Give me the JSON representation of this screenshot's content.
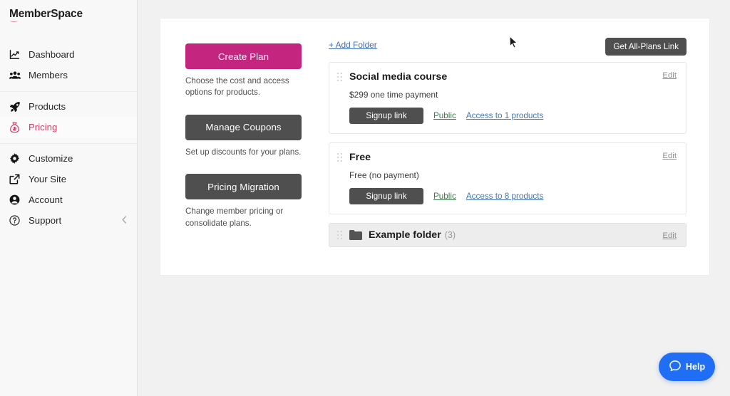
{
  "brand": {
    "name": "MemberSpace"
  },
  "sidebar": {
    "groups": [
      {
        "items": [
          {
            "label": "Dashboard",
            "icon": "chart-line-icon",
            "active": false
          },
          {
            "label": "Members",
            "icon": "users-icon",
            "active": false
          }
        ]
      },
      {
        "items": [
          {
            "label": "Products",
            "icon": "rocket-icon",
            "active": false
          },
          {
            "label": "Pricing",
            "icon": "money-bag-icon",
            "active": true
          }
        ]
      },
      {
        "items": [
          {
            "label": "Customize",
            "icon": "gear-icon",
            "active": false
          },
          {
            "label": "Your Site",
            "icon": "external-link-icon",
            "active": false
          },
          {
            "label": "Account",
            "icon": "user-circle-icon",
            "active": false
          },
          {
            "label": "Support",
            "icon": "question-circle-icon",
            "active": false,
            "trailing_icon": "chevron-left-icon"
          }
        ]
      }
    ]
  },
  "actions": {
    "create_plan": {
      "label": "Create Plan",
      "help": "Choose the cost and access options for products."
    },
    "manage_coupons": {
      "label": "Manage Coupons",
      "help": "Set up discounts for your plans."
    },
    "pricing_migration": {
      "label": "Pricing Migration",
      "help": "Change member pricing or consolidate plans."
    }
  },
  "plans": {
    "add_folder_label": "+ Add Folder",
    "all_plans_label": "Get All-Plans Link",
    "edit_label": "Edit",
    "items": [
      {
        "title": "Social media course",
        "price": "$299 one time payment",
        "signup_label": "Signup link",
        "visibility": "Public",
        "access": "Access to 1 products",
        "edit": "Edit"
      },
      {
        "title": "Free",
        "price": "Free (no payment)",
        "signup_label": "Signup link",
        "visibility": "Public",
        "access": "Access to 8 products",
        "edit": "Edit"
      }
    ],
    "folder": {
      "name": "Example folder",
      "count": "(3)",
      "edit": "Edit",
      "icon": "folder-icon"
    }
  },
  "help_widget": {
    "label": "Help",
    "icon": "chat-bubble-icon",
    "color": "#1f6ef5"
  },
  "colors": {
    "primary": "#c4257f",
    "dark_button": "#4f4f4f",
    "active_nav": "#cf3b63",
    "link_blue": "#4577b4",
    "link_green": "#3c7a4b",
    "page_bg": "#f1f1f1",
    "sidebar_bg": "#f8f8f8"
  }
}
